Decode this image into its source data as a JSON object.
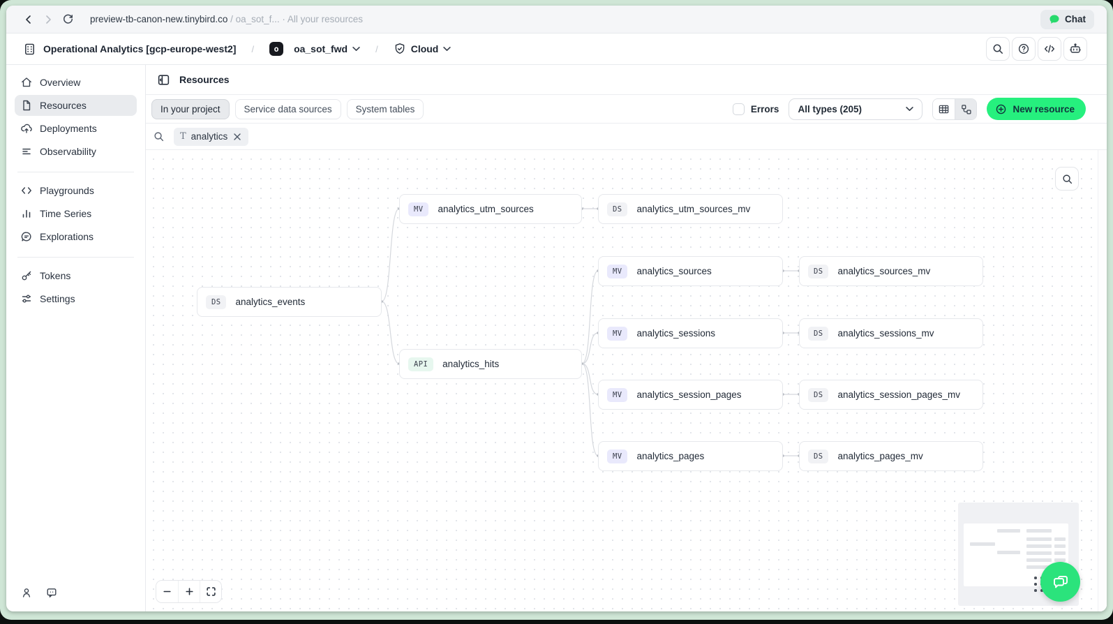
{
  "browser_bar": {
    "url_primary": "preview-tb-canon-new.tinybird.co",
    "url_secondary": " / oa_sot_f... · All your resources",
    "chat_button": "Chat"
  },
  "app_header": {
    "workspace_name": "Operational Analytics [gcp-europe-west2]",
    "path_separator_1": "/",
    "branch_badge": "o",
    "branch_name": "oa_sot_fwd",
    "path_separator_2": "/",
    "environment_name": "Cloud"
  },
  "sidebar": {
    "items": [
      {
        "label": "Overview"
      },
      {
        "label": "Resources",
        "active": true
      },
      {
        "label": "Deployments"
      },
      {
        "label": "Observability"
      },
      {
        "label": "Playgrounds"
      },
      {
        "label": "Time Series"
      },
      {
        "label": "Explorations"
      },
      {
        "label": "Tokens"
      },
      {
        "label": "Settings"
      }
    ]
  },
  "resources_page": {
    "title": "Resources",
    "tabs": [
      {
        "label": "In your project",
        "active": true
      },
      {
        "label": "Service data sources",
        "active": false
      },
      {
        "label": "System tables",
        "active": false
      }
    ],
    "errors_checkbox_label": "Errors",
    "type_filter_value": "All types (205)",
    "new_resource_button": "New resource",
    "search_filter": {
      "type_glyph": "T",
      "value": "analytics"
    }
  },
  "graph": {
    "nodes": [
      {
        "type": "MV",
        "label": "analytics_utm_sources"
      },
      {
        "type": "DS",
        "label": "analytics_utm_sources_mv"
      },
      {
        "type": "MV",
        "label": "analytics_sources"
      },
      {
        "type": "DS",
        "label": "analytics_sources_mv"
      },
      {
        "type": "DS",
        "label": "analytics_events"
      },
      {
        "type": "MV",
        "label": "analytics_sessions"
      },
      {
        "type": "DS",
        "label": "analytics_sessions_mv"
      },
      {
        "type": "API",
        "label": "analytics_hits"
      },
      {
        "type": "MV",
        "label": "analytics_session_pages"
      },
      {
        "type": "DS",
        "label": "analytics_session_pages_mv"
      },
      {
        "type": "MV",
        "label": "analytics_pages"
      },
      {
        "type": "DS",
        "label": "analytics_pages_mv"
      }
    ],
    "edges": [
      {
        "from": "analytics_events",
        "to": "analytics_utm_sources"
      },
      {
        "from": "analytics_events",
        "to": "analytics_hits"
      },
      {
        "from": "analytics_utm_sources",
        "to": "analytics_utm_sources_mv"
      },
      {
        "from": "analytics_hits",
        "to": "analytics_sources"
      },
      {
        "from": "analytics_hits",
        "to": "analytics_sessions"
      },
      {
        "from": "analytics_hits",
        "to": "analytics_session_pages"
      },
      {
        "from": "analytics_hits",
        "to": "analytics_pages"
      },
      {
        "from": "analytics_sources",
        "to": "analytics_sources_mv"
      },
      {
        "from": "analytics_sessions",
        "to": "analytics_sessions_mv"
      },
      {
        "from": "analytics_session_pages",
        "to": "analytics_session_pages_mv"
      },
      {
        "from": "analytics_pages",
        "to": "analytics_pages_mv"
      }
    ]
  },
  "colors": {
    "brand_green": "#26f07e",
    "frame_green": "#cfe6d6",
    "badge_mv_bg": "#e9e9fc",
    "badge_ds_bg": "#f1f2f5",
    "badge_api_bg": "#e7f7ef"
  }
}
